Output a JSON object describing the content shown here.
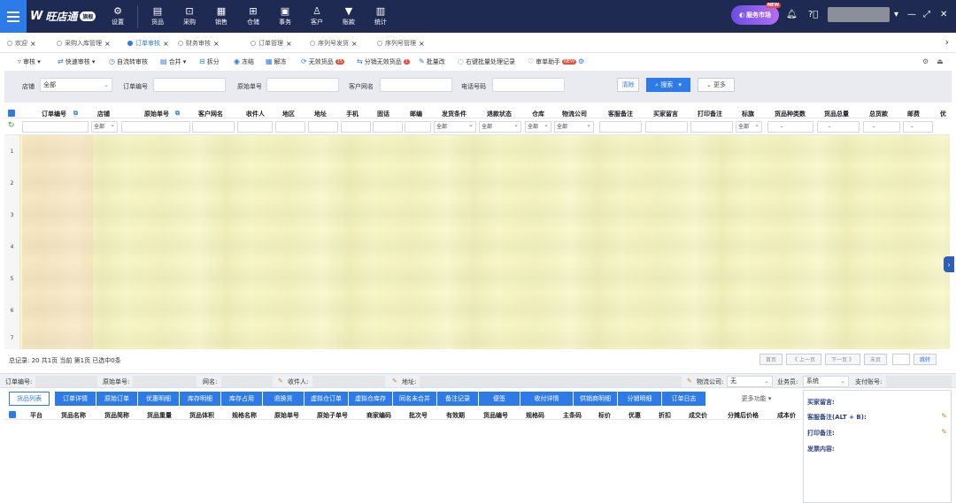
{
  "app": {
    "logo_text": "旺店通",
    "edition": "旗舰",
    "service_badge": "服务市场",
    "badge_new": "NEW"
  },
  "nav": [
    {
      "icon": "⚙",
      "label": "设置"
    },
    {
      "icon": "▤",
      "label": "货品"
    },
    {
      "icon": "⊡",
      "label": "采购"
    },
    {
      "icon": "▦",
      "label": "销售"
    },
    {
      "icon": "⊞",
      "label": "仓储"
    },
    {
      "icon": "▣",
      "label": "事务"
    },
    {
      "icon": "♙",
      "label": "客户"
    },
    {
      "icon": "▼",
      "label": "账款"
    },
    {
      "icon": "▥",
      "label": "统计"
    }
  ],
  "tabs": [
    {
      "label": "欢迎"
    },
    {
      "label": "采购入库管理"
    },
    {
      "label": "订单审核"
    },
    {
      "label": "财务审核"
    },
    {
      "label": "订单管理"
    },
    {
      "label": "序列号发货"
    },
    {
      "label": "序列号管理"
    }
  ],
  "toolbar": [
    {
      "label": "审核 ▾",
      "icon": "▿"
    },
    {
      "label": "快速审核 ▾",
      "icon": "⇄"
    },
    {
      "label": "自流转审核",
      "icon": "◷"
    },
    {
      "label": "合并 ▾",
      "icon": "▤"
    },
    {
      "label": "拆分",
      "icon": "⊟"
    },
    {
      "label": "冻结",
      "icon": "◉"
    },
    {
      "label": "解冻",
      "icon": "▦"
    },
    {
      "label": "无效货品",
      "icon": "⟳",
      "badge": "15"
    },
    {
      "label": "分销无效货品",
      "icon": "⇆",
      "badge": "1"
    },
    {
      "label": "批量改",
      "icon": "✎"
    },
    {
      "label": "右键批量处理记录",
      "icon": "◌"
    },
    {
      "label": "审单助手",
      "icon": "♡",
      "badge": "NEW"
    }
  ],
  "filter": {
    "shop_label": "店铺",
    "shop_value": "全部",
    "order_no_label": "订单编号",
    "origin_no_label": "原始单号",
    "customer_label": "客户网名",
    "phone_label": "电话号码",
    "clear": "清除",
    "search": "搜索",
    "more": "更多"
  },
  "grid": {
    "columns": [
      "订单编号",
      "店铺",
      "原始单号",
      "客户网名",
      "收件人",
      "地区",
      "地址",
      "手机",
      "固话",
      "邮编",
      "发货条件",
      "退款状态",
      "仓库",
      "物流公司",
      "客服备注",
      "买家留言",
      "打印备注",
      "标旗",
      "货品种类数",
      "货品总量",
      "总货款",
      "邮费",
      "优"
    ],
    "filter_values": [
      "全部",
      "全部",
      "全部",
      "全部",
      "全部"
    ],
    "row_numbers": [
      "1",
      "2",
      "3",
      "4",
      "5",
      "6",
      "7"
    ]
  },
  "pager": {
    "summary": "总记录: 20  共1页  当前 第1页  已选中0条",
    "first": "首页",
    "prev": "《 上一页",
    "next": "下一页 》",
    "last": "末页",
    "go": "跳转"
  },
  "detail": {
    "order_no": "订单编号:",
    "origin_no": "原始单号:",
    "net_name": "网名:",
    "receiver": "收件人:",
    "address": "地址:",
    "logistics": "物流公司:",
    "logistics_value": "无",
    "salesman": "业务员:",
    "salesman_value": "系统",
    "pay_account": "支付账号:"
  },
  "subtabs": [
    "货品列表",
    "订单详情",
    "原始订单",
    "优惠明细",
    "库存明细",
    "库存占用",
    "退换货",
    "虚拟仓订单",
    "虚拟仓库存",
    "同名未合并",
    "备注记录",
    "便签",
    "收付详情",
    "供销商明细",
    "分销明细",
    "订单日志",
    "更多功能 ▾"
  ],
  "subcolumns": [
    "平台",
    "货品名称",
    "货品简称",
    "货品重量",
    "货品体积",
    "规格名称",
    "原始单号",
    "原始子单号",
    "商家编码",
    "批次号",
    "有效期",
    "货品编号",
    "规格码",
    "主条码",
    "标价",
    "优惠",
    "折扣",
    "成交价",
    "分摊后价格",
    "成本价"
  ],
  "right_panel": {
    "buyer_msg": "买家留言:",
    "cs_note": "客服备注(ALT + B):",
    "print_note": "打印备注:",
    "invoice": "发票内容:"
  }
}
